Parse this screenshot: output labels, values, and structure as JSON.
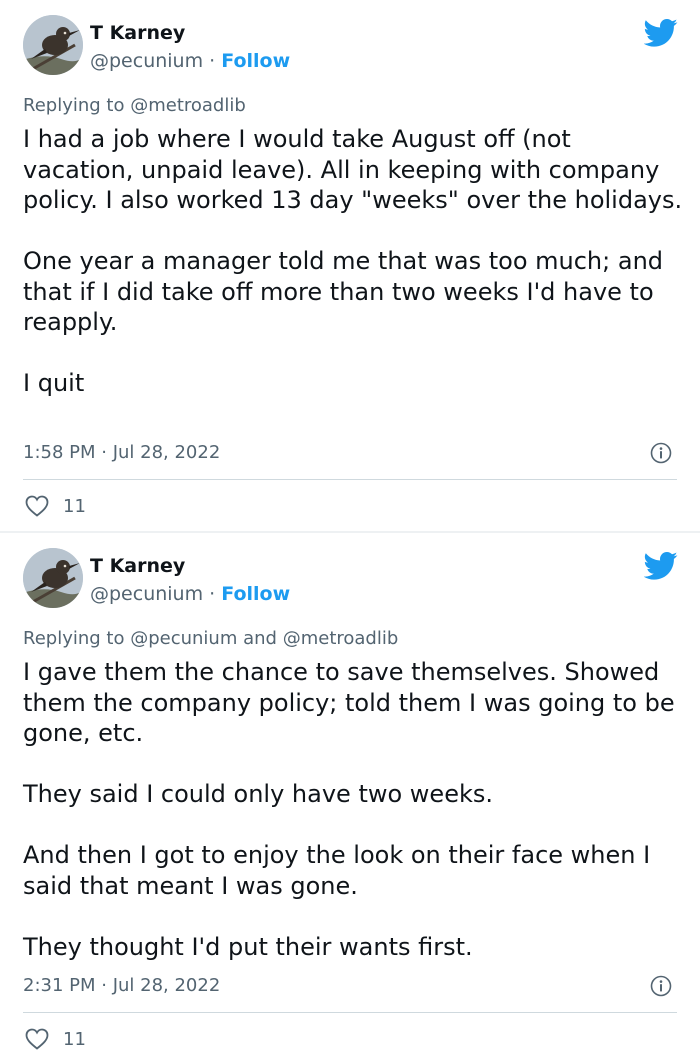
{
  "tweets": [
    {
      "author_name": "T Karney",
      "handle": "@pecunium",
      "separator": "·",
      "follow_label": "Follow",
      "replying_prefix": "Replying to",
      "mentions": [
        "@metroadlib"
      ],
      "mention_joiner": "",
      "paragraphs": [
        "I had a job where I would take August off (not vacation, unpaid leave).  All in keeping with company policy.  I also worked 13 day \"weeks\" over the holidays.",
        "One year a manager told me that was too much; and that if I did take off more than two weeks I'd have to reapply.",
        "I quit"
      ],
      "timestamp": "1:58 PM · Jul 28, 2022",
      "like_count": "11"
    },
    {
      "author_name": "T Karney",
      "handle": "@pecunium",
      "separator": "·",
      "follow_label": "Follow",
      "replying_prefix": "Replying to",
      "mentions": [
        "@pecunium",
        "@metroadlib"
      ],
      "mention_joiner": "and",
      "paragraphs": [
        "I gave them the chance to save themselves. Showed them the company policy; told them I was going to be gone, etc.",
        "They said I could only have two weeks.",
        "And then I got to enjoy the look on their face when I said that meant I was gone.",
        "They thought I'd put their wants first."
      ],
      "timestamp": "2:31 PM · Jul 28, 2022",
      "like_count": "11"
    }
  ],
  "icons": {
    "brand": "twitter-bird-icon",
    "info": "info-circle-icon",
    "like": "heart-outline-icon"
  },
  "colors": {
    "accent": "#1d9bf0",
    "text": "#0f1419",
    "muted": "#536471",
    "divider": "#cfd9de",
    "page_bg": "#eef1f3"
  }
}
